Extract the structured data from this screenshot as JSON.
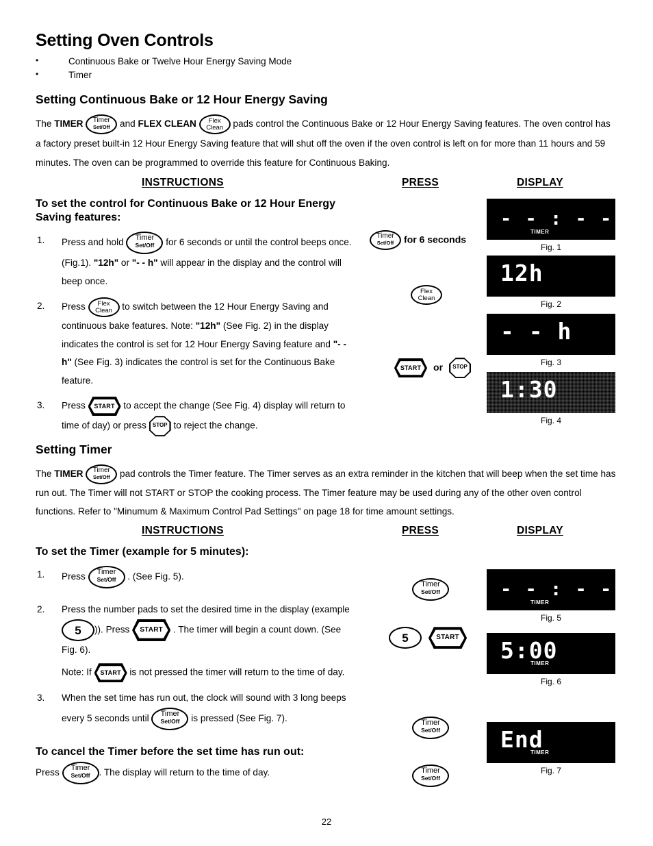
{
  "page": {
    "title": "Setting Oven Controls",
    "page_number": "22",
    "bullets": [
      "Continuous Bake or Twelve Hour Energy Saving Mode",
      "Timer"
    ]
  },
  "column_headers": {
    "instructions": "INSTRUCTIONS",
    "press": "PRESS",
    "display": "DISPLAY"
  },
  "pads": {
    "timer_line1": "Timer",
    "timer_line2": "Set/Off",
    "flex_line1": "Flex",
    "flex_line2": "Clean",
    "start": "START",
    "stop": "STOP",
    "number_five": "5"
  },
  "section1": {
    "heading": "Setting Continuous Bake or 12 Hour Energy Saving",
    "intro_a": "The ",
    "intro_timer_label": "TIMER",
    "intro_b": " and ",
    "intro_flex_label": "FLEX CLEAN",
    "intro_c": " pads control the Continuous Bake or 12 Hour Energy Saving features. The oven control has a factory preset built-in 12 Hour Energy Saving feature that will shut off the oven if the oven control is left on for more than 11 hours and 59 minutes. The oven can be programmed to override this feature for Continuous Baking.",
    "subheading": "To set the control for Continuous Bake or 12 Hour Energy Saving features:",
    "steps": [
      {
        "num": "1.",
        "a": "Press and hold ",
        "b": " for 6 seconds or until the control beeps once.  (Fig.1). ",
        "bold1": "\"12h\"",
        "c": " or ",
        "bold2": "\"- - h\"",
        "d": " will appear in the display and the control will beep once."
      },
      {
        "num": "2.",
        "a": "Press ",
        "b": " to switch between the 12 Hour Energy Saving and continuous bake features. Note: ",
        "bold1": "\"12h\"",
        "c": " (See Fig. 2) in the display indicates the control is set for 12 Hour Energy Saving feature and ",
        "bold2": "\"- - h\"",
        "d": " (See Fig. 3) indicates the control is set for the Continuous Bake feature."
      },
      {
        "num": "3.",
        "a": "Press ",
        "b": " to accept the change (See Fig. 4) display will return to time of day) or press ",
        "c": " to reject the change."
      }
    ],
    "press_rows": {
      "row1_suffix": "for 6 seconds",
      "row3_or": "or"
    },
    "figures": [
      {
        "id": "fig1",
        "value": "- - : - -",
        "tag": "TIMER",
        "caption": "Fig. 1",
        "style": "dashes"
      },
      {
        "id": "fig2",
        "value": "12h",
        "tag": "",
        "caption": "Fig. 2",
        "style": "normal"
      },
      {
        "id": "fig3",
        "value": "- - h",
        "tag": "",
        "caption": "Fig. 3",
        "style": "normal"
      },
      {
        "id": "fig4",
        "value": "1:30",
        "tag": "",
        "caption": "Fig. 4",
        "style": "noisy"
      }
    ]
  },
  "section2": {
    "heading": "Setting Timer",
    "intro_a": "The ",
    "intro_timer_label": "TIMER",
    "intro_b": " pad controls the Timer feature. The Timer serves as an extra reminder in the kitchen that will beep when the set time has run out. The Timer will not START or STOP the cooking process. The Timer feature may be used during any of the other oven control functions. Refer to \"Minumum  & Maximum Control Pad Settings\" on page 18 for time amount settings.",
    "subheading": "To set the Timer (example for 5 minutes):",
    "steps": [
      {
        "num": "1.",
        "a": "Press ",
        "b": " . (See Fig. 5)."
      },
      {
        "num": "2.",
        "a": "Press the number pads to set the desired time in the display (example ",
        "b": ")).  Press ",
        "c": " . The timer will begin a count down. (See Fig. 6).",
        "note_a": "Note: If ",
        "note_b": " is not pressed the timer will return to the time of day."
      },
      {
        "num": "3.",
        "a": "When the set time has run out, the clock will sound with 3 long beeps every 5 seconds until ",
        "b": " is pressed (See Fig. 7)."
      }
    ],
    "cancel_heading": "To cancel the Timer before the set time has run out:",
    "cancel_a": "Press ",
    "cancel_b": ".  The display will return to the time of day.",
    "figures": [
      {
        "id": "fig5",
        "value": "- - : - -",
        "tag": "TIMER",
        "caption": "Fig. 5",
        "style": "dashes"
      },
      {
        "id": "fig6",
        "value": "5:00",
        "tag": "TIMER",
        "caption": "Fig. 6",
        "style": "normal"
      },
      {
        "id": "fig7",
        "value": "End",
        "tag": "TIMER",
        "caption": "Fig. 7",
        "style": "normal"
      }
    ]
  }
}
